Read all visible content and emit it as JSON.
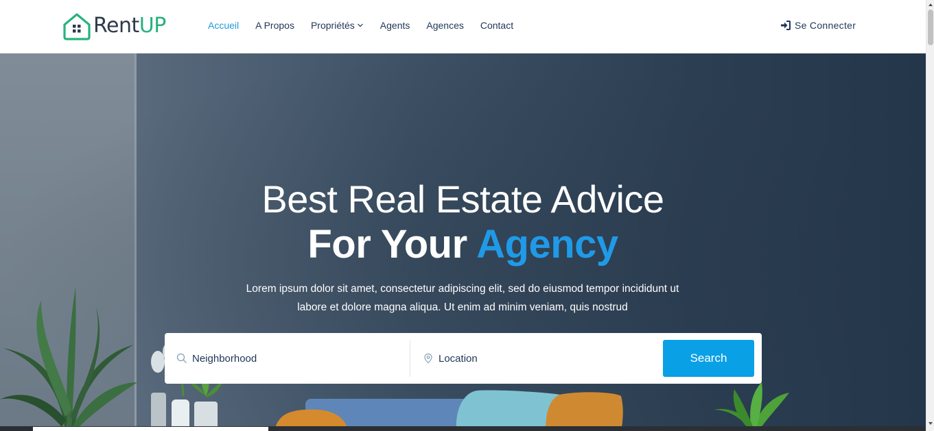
{
  "brand": {
    "name_part1": "Rent",
    "name_part2": "UP",
    "primary_color": "#28b27d"
  },
  "nav": {
    "items": [
      {
        "label": "Accueil",
        "active": true
      },
      {
        "label": "A Propos",
        "active": false
      },
      {
        "label": "Propriétés",
        "active": false,
        "dropdown": true
      },
      {
        "label": "Agents",
        "active": false
      },
      {
        "label": "Agences",
        "active": false
      },
      {
        "label": "Contact",
        "active": false
      }
    ],
    "login_label": "Se Connecter",
    "login_icon": "sign-in-icon"
  },
  "hero": {
    "title_line1": "Best Real Estate Advice",
    "title_line2_prefix": "For Your",
    "title_line2_accent": "Agency",
    "accent_color": "#1f9ae8",
    "description_line1": "Lorem ipsum dolor sit amet, consectetur adipiscing elit, sed do eiusmod tempor incididunt ut",
    "description_line2": "labore et dolore magna aliqua. Ut enim ad minim veniam, quis nostrud"
  },
  "search": {
    "neighborhood_placeholder": "Neighborhood",
    "neighborhood_icon": "search-icon",
    "location_placeholder": "Location",
    "location_icon": "map-pin-icon",
    "button_label": "Search",
    "button_color": "#0aa0e6"
  }
}
